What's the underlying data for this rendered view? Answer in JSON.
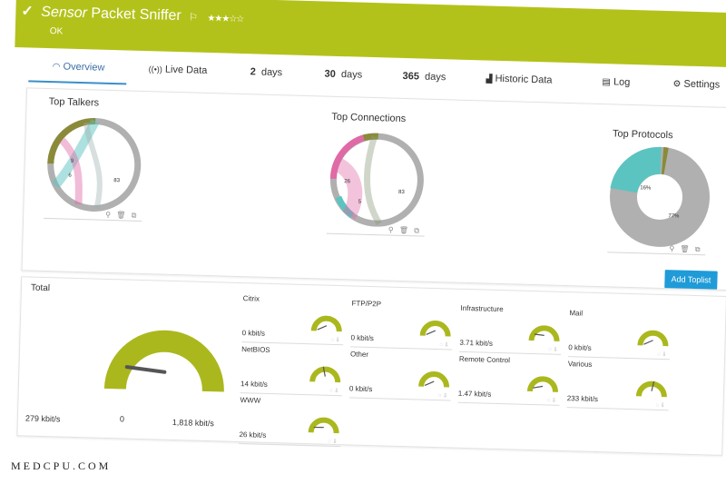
{
  "header": {
    "sensor_word": "Sensor",
    "name": "Packet Sniffer",
    "status": "OK",
    "stars": "★★★☆☆"
  },
  "tabs": [
    {
      "label": "Overview",
      "icon": "gauge-icon"
    },
    {
      "label": "Live Data",
      "icon": "live-signal-icon"
    },
    {
      "num": "2",
      "label": "days"
    },
    {
      "num": "30",
      "label": "days"
    },
    {
      "num": "365",
      "label": "days"
    },
    {
      "label": "Historic Data",
      "icon": "area-chart-icon"
    },
    {
      "label": "Log",
      "icon": "log-icon"
    },
    {
      "label": "Settings",
      "icon": "gear-icon"
    }
  ],
  "toplists": {
    "talkers": {
      "title": "Top Talkers",
      "labels": [
        "9",
        "6",
        "83"
      ]
    },
    "connections": {
      "title": "Top Connections",
      "labels": [
        "26",
        "5",
        "83"
      ]
    },
    "protocols": {
      "title": "Top Protocols",
      "labels": [
        "16%",
        "77%"
      ]
    },
    "add_button": "Add Toplist"
  },
  "total": {
    "label": "Total",
    "value": "279 kbit/s",
    "min": "0",
    "max": "1,818 kbit/s",
    "fraction": 0.15
  },
  "channels": [
    {
      "name": "Citrix",
      "value": "0 kbit/s",
      "fraction": 0.02
    },
    {
      "name": "FTP/P2P",
      "value": "0 kbit/s",
      "fraction": 0.02
    },
    {
      "name": "Infrastructure",
      "value": "3.71 kbit/s",
      "fraction": 0.15
    },
    {
      "name": "Mail",
      "value": "0 kbit/s",
      "fraction": 0.02
    },
    {
      "name": "NetBIOS",
      "value": "14 kbit/s",
      "fraction": 0.45
    },
    {
      "name": "Other",
      "value": "0 kbit/s",
      "fraction": 0.02
    },
    {
      "name": "Remote Control",
      "value": "1.47 kbit/s",
      "fraction": 0.08
    },
    {
      "name": "Various",
      "value": "233 kbit/s",
      "fraction": 0.55
    },
    {
      "name": "WWW",
      "value": "26 kbit/s",
      "fraction": 0.12
    }
  ],
  "watermark": "MEDCPU.COM",
  "colors": {
    "brand": "#b3c21a",
    "gauge": "#aab81e",
    "accent": "#1f9bd8",
    "donut_gray": "#b0b0b0",
    "pink": "#e06aa6",
    "teal": "#5cc4c0",
    "olive": "#8a8a3a"
  }
}
